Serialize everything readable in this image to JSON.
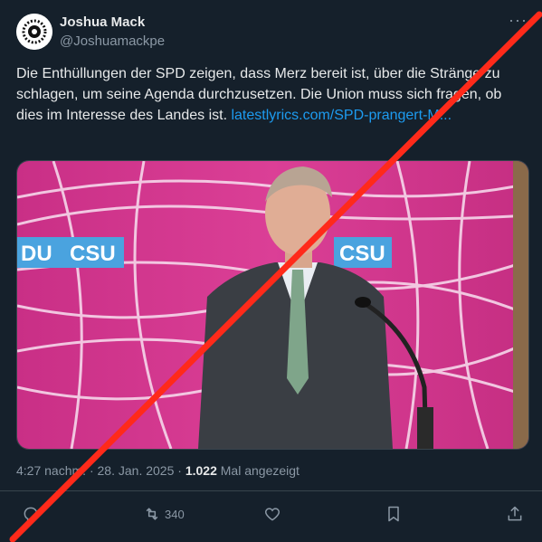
{
  "author": {
    "name": "Joshua Mack",
    "handle": "@Joshuamackpe"
  },
  "tweet": {
    "text": "Die Enthüllungen der SPD zeigen, dass Merz bereit ist, über die Stränge zu schlagen, um seine Agenda durchzusetzen. Die Union muss sich fragen, ob dies im Interesse des Landes ist. ",
    "link": "latestlyrics.com/SPD-prangert-M..."
  },
  "media": {
    "banner_left": "DU",
    "banner_left_logo": "CSU",
    "banner_right_logo": "CSU"
  },
  "meta": {
    "time": "4:27 nachm.",
    "separator": "·",
    "date": "28. Jan. 2025",
    "views_count": "1.022",
    "views_label": "Mal angezeigt"
  },
  "actions": {
    "retweet_count": "340"
  },
  "colors": {
    "background": "#15202b",
    "link": "#1d9bf0",
    "cross": "#ff2a1a",
    "backdrop_pink": "#d6398f"
  },
  "icons": [
    "more-icon",
    "reply-icon",
    "retweet-icon",
    "like-icon",
    "bookmark-icon",
    "share-icon"
  ]
}
